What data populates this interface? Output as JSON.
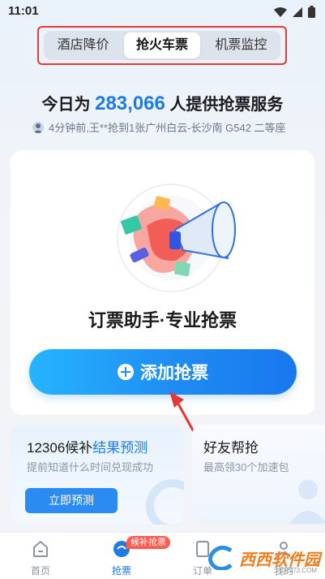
{
  "status_bar": {
    "time": "11:01"
  },
  "tabs": [
    {
      "label": "酒店降价",
      "active": false
    },
    {
      "label": "抢火车票",
      "active": true
    },
    {
      "label": "机票监控",
      "active": false
    }
  ],
  "headline": {
    "prefix": "今日为",
    "count": "283,066",
    "suffix": "人提供抢票服务"
  },
  "recent_activity": "4分钟前,王**抢到1张广州白云-长沙南 G542 二等座",
  "main_card": {
    "title": "订票助手·专业抢票",
    "add_button_label": "添加抢票"
  },
  "predict_card": {
    "title_prefix": "12306候补",
    "title_highlight": "结果预测",
    "description": "提前知道什么时间兑现成功",
    "button_label": "立即预测"
  },
  "friend_card": {
    "title": "好友帮抢",
    "description": "最高领30个加速包"
  },
  "bottom_nav": {
    "items": [
      {
        "label": "首页",
        "active": false
      },
      {
        "label": "抢票",
        "active": true
      },
      {
        "label": "订单",
        "active": false
      },
      {
        "label": "我的",
        "active": false
      }
    ],
    "badge": "候补抢票"
  },
  "watermark": {
    "text": "西西软件园",
    "sub": "CR173.COM"
  },
  "colors": {
    "accent": "#1e7be6",
    "highlight_box": "#e53935",
    "badge": "#ff5a4e"
  }
}
